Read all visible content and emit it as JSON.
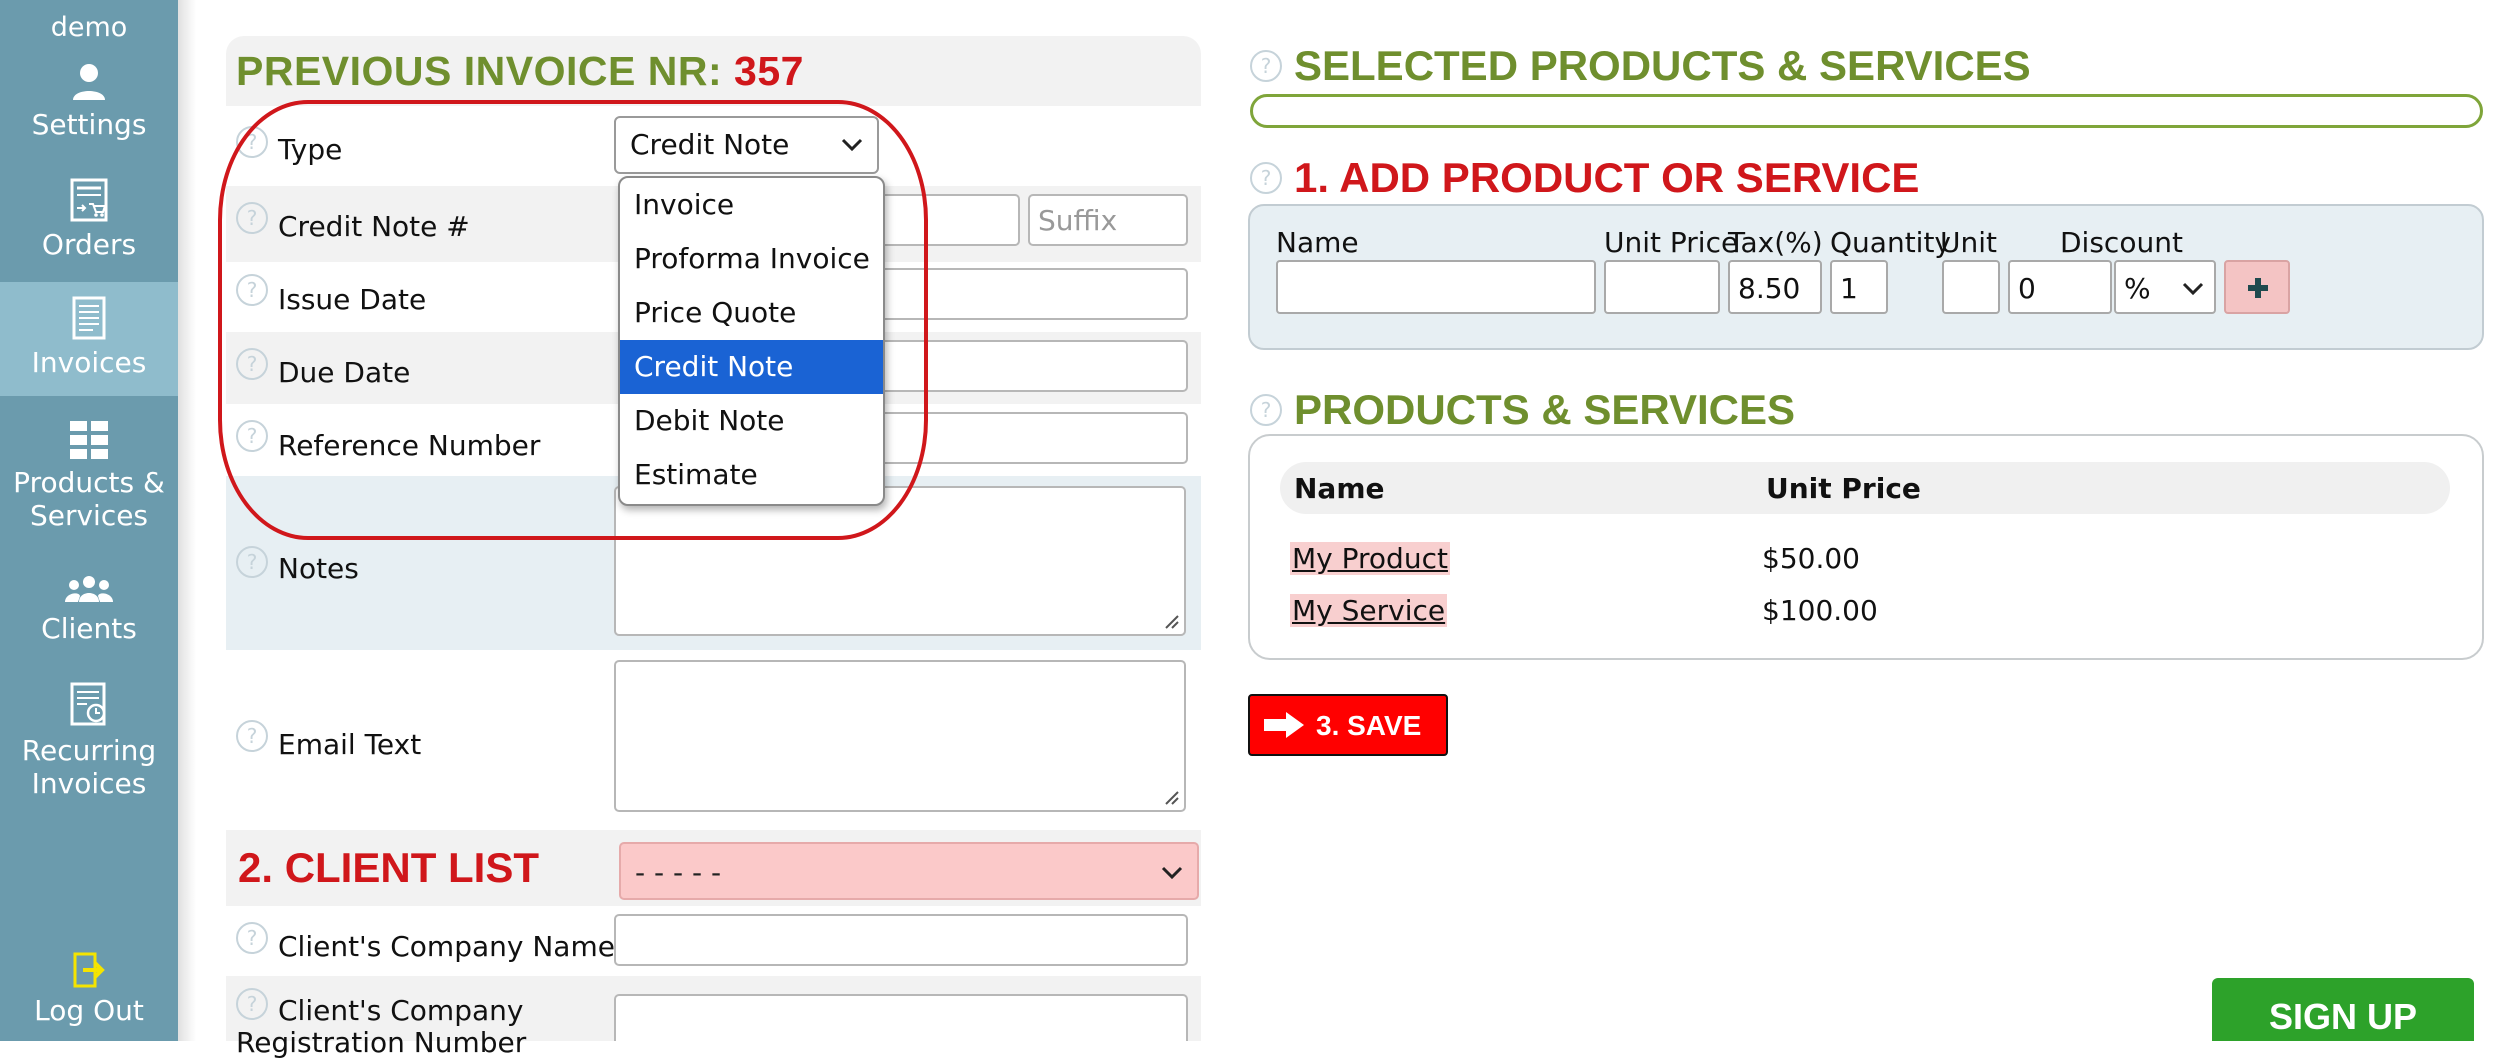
{
  "sidebar": {
    "user": "demo",
    "items": [
      {
        "label": "Settings",
        "icon": "user-icon"
      },
      {
        "label": "Orders",
        "icon": "orders-icon"
      },
      {
        "label": "Invoices",
        "icon": "invoice-icon"
      },
      {
        "label_line1": "Products &",
        "label_line2": "Services",
        "icon": "grid-icon"
      },
      {
        "label": "Clients",
        "icon": "clients-icon"
      },
      {
        "label_line1": "Recurring",
        "label_line2": "Invoices",
        "icon": "recurring-icon"
      },
      {
        "label": "Log Out",
        "icon": "logout-icon"
      }
    ]
  },
  "invoice_form": {
    "title_prefix": "PREVIOUS INVOICE NR:",
    "title_number": "357",
    "type_label": "Type",
    "type_value": "Credit Note",
    "type_options": [
      "Invoice",
      "Proforma Invoice",
      "Price Quote",
      "Credit Note",
      "Debit Note",
      "Estimate"
    ],
    "credit_note_label": "Credit Note #",
    "suffix_placeholder": "Suffix",
    "issue_date_label": "Issue Date",
    "due_date_label": "Due Date",
    "reference_label": "Reference Number",
    "notes_label": "Notes",
    "email_text_label": "Email Text"
  },
  "client_list": {
    "title": "2. CLIENT LIST",
    "select_value": "- - - - -",
    "company_name_label": "Client's Company Name",
    "company_reg_label_line1": "Client's Company",
    "company_reg_label_line2": "Registration Number"
  },
  "selected": {
    "title": "SELECTED PRODUCTS & SERVICES"
  },
  "add_product": {
    "title": "1. ADD PRODUCT OR SERVICE",
    "columns": [
      "Name",
      "Unit Price",
      "Tax(%)",
      "Quantity",
      "Unit",
      "Discount"
    ],
    "tax_value": "8.50",
    "quantity_value": "1",
    "discount_value": "0",
    "discount_type": "%"
  },
  "products": {
    "title": "PRODUCTS & SERVICES",
    "headers": [
      "Name",
      "Unit Price"
    ],
    "rows": [
      {
        "name": "My Product",
        "price": "$50.00"
      },
      {
        "name": "My Service",
        "price": "$100.00"
      }
    ]
  },
  "actions": {
    "save_label": "3. SAVE",
    "signup_label": "SIGN UP"
  },
  "colors": {
    "sidebar": "#6b9bad",
    "accent_green": "#6f8f2e",
    "accent_red": "#d0171b",
    "selected_option": "#1a63d4",
    "signup": "#2da22a"
  }
}
